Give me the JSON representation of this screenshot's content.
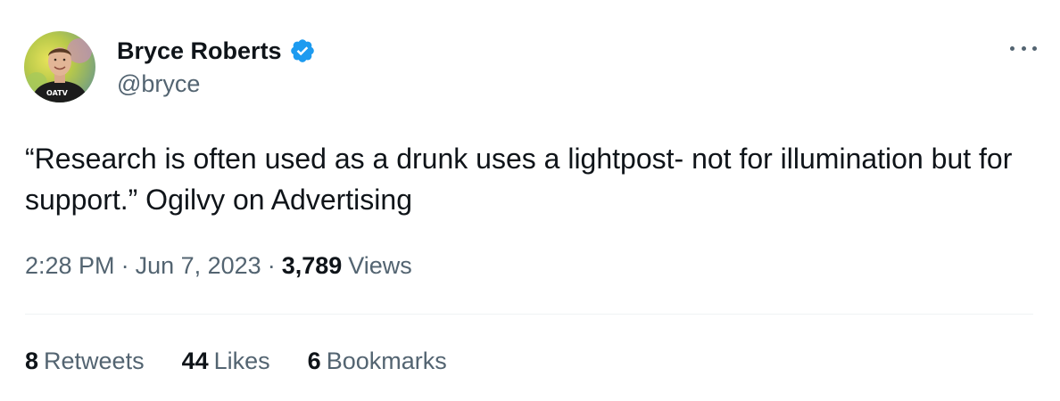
{
  "author": {
    "display_name": "Bryce Roberts",
    "handle": "@bryce",
    "verified": true,
    "avatar_shirt_text": "OATV"
  },
  "tweet": {
    "text": "“Research is often used as a drunk uses a lightpost- not for illumination but for support.” Ogilvy on Advertising"
  },
  "meta": {
    "time": "2:28 PM",
    "separator": "·",
    "date": "Jun 7, 2023",
    "views_count": "3,789",
    "views_label": "Views"
  },
  "stats": {
    "retweets_count": "8",
    "retweets_label": "Retweets",
    "likes_count": "44",
    "likes_label": "Likes",
    "bookmarks_count": "6",
    "bookmarks_label": "Bookmarks"
  },
  "colors": {
    "text_primary": "#0f1419",
    "text_secondary": "#536471",
    "verified_blue": "#1d9bf0",
    "divider": "#eff3f4"
  },
  "icons": {
    "verified": "verified-badge-icon",
    "more": "more-options-icon"
  }
}
